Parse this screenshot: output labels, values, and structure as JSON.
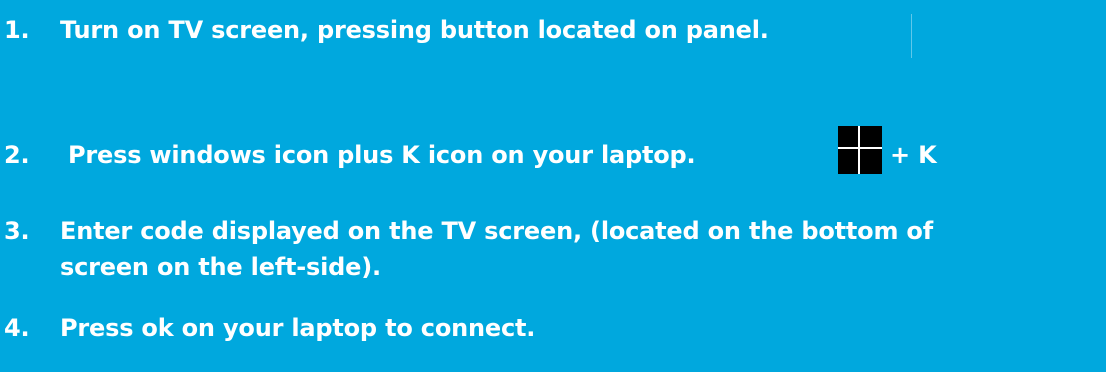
{
  "steps": [
    {
      "number": "1.",
      "text": "Turn on TV screen, pressing button located on panel."
    },
    {
      "number": "2.",
      "text": "Press windows icon plus K icon on your laptop."
    },
    {
      "number": "3.",
      "text": "Enter code displayed on the TV screen, (located on the bottom of",
      "text_line2": "screen on the left-side)."
    },
    {
      "number": "4.",
      "text": "Press ok on your laptop to connect."
    }
  ],
  "shortcut": {
    "icon": "windows-logo-icon",
    "suffix": "+ K"
  },
  "colors": {
    "background": "#00a8de",
    "text": "#ffffff",
    "icon": "#000000"
  }
}
